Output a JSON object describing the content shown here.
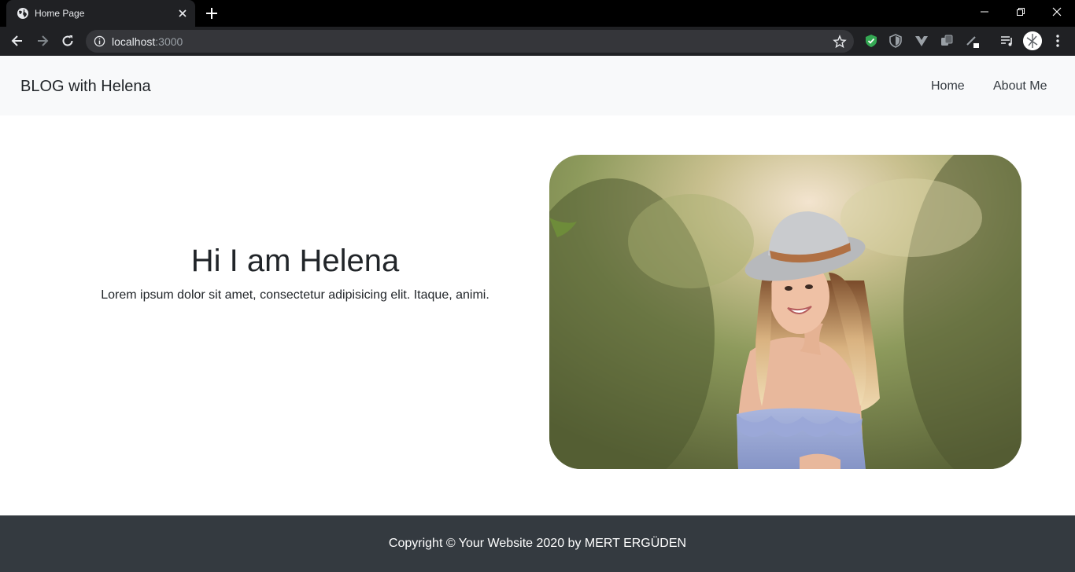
{
  "browser": {
    "tab_title": "Home Page",
    "url_host": "localhost",
    "url_port": ":3000"
  },
  "navbar": {
    "brand": "BLOG with Helena",
    "links": [
      "Home",
      "About Me"
    ]
  },
  "hero": {
    "title": "Hi I am Helena",
    "text": "Lorem ipsum dolor sit amet, consectetur adipisicing elit. Itaque, animi.",
    "photo_alt": "Woman in a grey hat and blue dress smiling over her shoulder in a green forest"
  },
  "footer": {
    "text": "Copyright © Your Website 2020 by MERT ERGÜDEN"
  },
  "colors": {
    "navbar_bg": "#f8f9fa",
    "footer_bg": "#343a40",
    "chrome_bg": "#202124",
    "shield_green": "#34a853"
  }
}
